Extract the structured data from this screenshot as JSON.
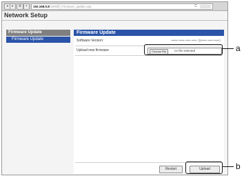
{
  "browser": {
    "back": "◂",
    "forward": "▸",
    "bookmarks": "⊞",
    "add": "+",
    "url_host": "192.168.0.8",
    "url_path": "/1000/fl_Firmware_update.asp",
    "reload": "C"
  },
  "app": {
    "title": "Network Setup"
  },
  "sidebar": {
    "heading": "Firmware Update",
    "items": [
      {
        "label": "Firmware Update",
        "selected": true
      }
    ]
  },
  "main": {
    "heading": "Firmware Update",
    "software_version_label": "Software Version:",
    "software_version_value": "•••••-••••-••••-•••• (5••••-••••-••••)",
    "upload_label": "Upload new firmware",
    "choose_file_label": "Choose File",
    "no_file_text": "no file selected",
    "restart_label": "Restart",
    "upload_button_label": "Upload"
  },
  "callouts": {
    "a": "a",
    "b": "b"
  },
  "colors": {
    "accent": "#2b54a8",
    "sidebar_header": "#7f7f7f"
  }
}
